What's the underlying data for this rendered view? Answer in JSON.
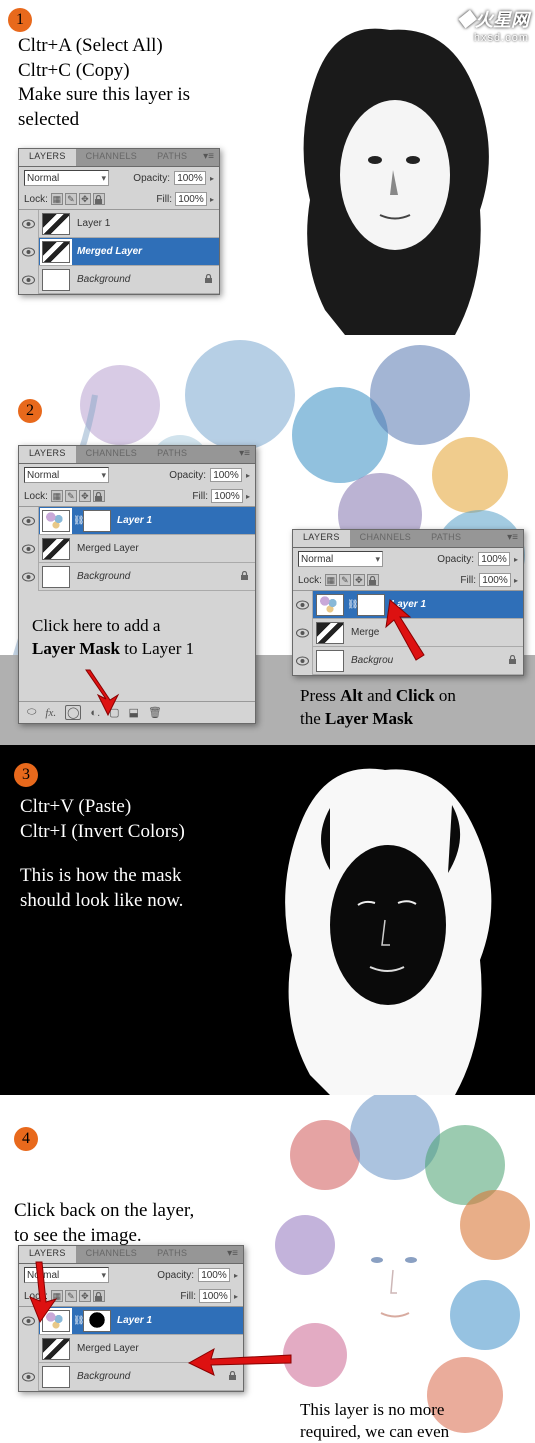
{
  "watermark": {
    "line1": "火星网",
    "line2": "hxsd.com",
    "icon": "◆"
  },
  "panel_common": {
    "tabs": {
      "layers": "LAYERS",
      "channels": "CHANNELS",
      "paths": "PATHS"
    },
    "blend_mode": "Normal",
    "opacity_label": "Opacity:",
    "opacity_value": "100%",
    "lock_label": "Lock:",
    "fill_label": "Fill:",
    "fill_value": "100%"
  },
  "step1": {
    "num": "1",
    "text_l1": "Cltr+A (Select All)",
    "text_l2": "Cltr+C (Copy)",
    "text_l3": "Make sure this layer is",
    "text_l4": "selected",
    "layers": [
      {
        "name": "Layer 1"
      },
      {
        "name": "Merged Layer"
      },
      {
        "name": "Background"
      }
    ]
  },
  "step2": {
    "num": "2",
    "text_left_l1": "Click here to add a",
    "text_left_l2a": "Layer Mask",
    "text_left_l2b": " to Layer 1",
    "text_right_l1a": "Press ",
    "text_right_l1b": "Alt",
    "text_right_l1c": " and ",
    "text_right_l1d": "Click",
    "text_right_l1e": " on",
    "text_right_l2a": "the ",
    "text_right_l2b": "Layer Mask",
    "layers_left": [
      {
        "name": "Layer 1"
      },
      {
        "name": "Merged Layer"
      },
      {
        "name": "Background"
      }
    ],
    "layers_right": [
      {
        "name": "Layer 1"
      },
      {
        "name_partial": "Merge"
      },
      {
        "name_partial": "Backgrou"
      }
    ]
  },
  "step3": {
    "num": "3",
    "text_l1": "Cltr+V (Paste)",
    "text_l2": "Cltr+I (Invert Colors)",
    "text_l3": "This is how the mask",
    "text_l4": "should look like now."
  },
  "step4": {
    "num": "4",
    "text_l1": "Click back on the layer,",
    "text_l2": "to see the image.",
    "text2_l1": "This layer is no more",
    "text2_l2": "required, we can even",
    "layers": [
      {
        "name": "Layer 1"
      },
      {
        "name": "Merged Layer"
      },
      {
        "name": "Background"
      }
    ]
  }
}
